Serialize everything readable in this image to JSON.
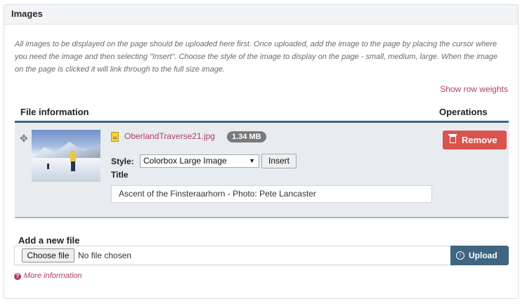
{
  "panel": {
    "title": "Images",
    "description": "All images to be displayed on the page should be uploaded here first. Once uploaded, add the image to the page by placing the cursor where you need the image and then selecting \"Insert\". Choose the style of the image to display on the page - small, medium, large. When the image on the page is clicked it will link through to the full size image.",
    "row_weights_link": "Show row weights"
  },
  "table": {
    "headers": {
      "file": "File information",
      "operations": "Operations"
    },
    "rows": [
      {
        "file_name": "OberlandTraverse21.jpg",
        "file_size": "1.34 MB",
        "style_label": "Style:",
        "style_value": "Colorbox Large Image",
        "insert_label": "Insert",
        "title_label": "Title",
        "title_value": "Ascent of the Finsteraarhorn - Photo: Pete Lancaster",
        "remove_label": "Remove"
      }
    ]
  },
  "add_file": {
    "label": "Add a new file",
    "choose_label": "Choose file",
    "no_file_text": "No file chosen",
    "upload_label": "Upload",
    "more_info": "More information"
  },
  "icons": {
    "drag": "drag-handle-icon",
    "file": "image-file-icon",
    "trash": "trash-icon",
    "upload": "upload-icon",
    "help": "help-icon"
  },
  "colors": {
    "accent": "#3f6581",
    "link": "#b13f5f",
    "danger": "#d9534f",
    "badge": "#7a7a7a"
  }
}
